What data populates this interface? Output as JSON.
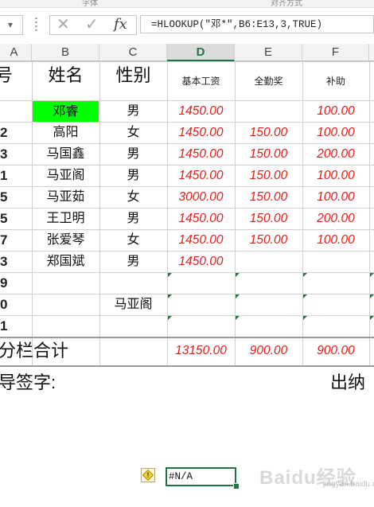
{
  "ribbon": {
    "group_left": "字体",
    "group_right": "对齐方式"
  },
  "formula_bar": {
    "cancel_glyph": "✕",
    "enter_glyph": "✓",
    "fx_label": "fx",
    "formula": "=HLOOKUP(\"邓*\",B6:E13,3,TRUE)"
  },
  "columns": [
    {
      "label": "A",
      "selected": false
    },
    {
      "label": "B",
      "selected": false
    },
    {
      "label": "C",
      "selected": false
    },
    {
      "label": "D",
      "selected": true
    },
    {
      "label": "E",
      "selected": false
    },
    {
      "label": "F",
      "selected": false
    }
  ],
  "table": {
    "headers": {
      "a": "号",
      "b": "姓名",
      "c": "性别",
      "d": "基本工资",
      "e": "全勤奖",
      "f": "补助"
    },
    "rows": [
      {
        "no": "",
        "name": "邓睿",
        "gender": "男",
        "base": "1450.00",
        "attend": "",
        "subsidy": "100.00"
      },
      {
        "no": "2",
        "name": "高阳",
        "gender": "女",
        "base": "1450.00",
        "attend": "150.00",
        "subsidy": "100.00"
      },
      {
        "no": "3",
        "name": "马国鑫",
        "gender": "男",
        "base": "1450.00",
        "attend": "150.00",
        "subsidy": "200.00"
      },
      {
        "no": "1",
        "name": "马亚阁",
        "gender": "男",
        "base": "1450.00",
        "attend": "150.00",
        "subsidy": "100.00"
      },
      {
        "no": "5",
        "name": "马亚茹",
        "gender": "女",
        "base": "3000.00",
        "attend": "150.00",
        "subsidy": "100.00"
      },
      {
        "no": "5",
        "name": "王卫明",
        "gender": "男",
        "base": "1450.00",
        "attend": "150.00",
        "subsidy": "200.00"
      },
      {
        "no": "7",
        "name": "张爱琴",
        "gender": "女",
        "base": "1450.00",
        "attend": "150.00",
        "subsidy": "100.00"
      },
      {
        "no": "3",
        "name": "郑国斌",
        "gender": "男",
        "base": "1450.00",
        "attend": "",
        "subsidy": ""
      },
      {
        "no": "9",
        "name": "",
        "gender": "",
        "base": "",
        "attend": "",
        "subsidy": ""
      },
      {
        "no": "0",
        "name": "",
        "gender": "马亚阁",
        "base": "",
        "attend": "",
        "subsidy": ""
      },
      {
        "no": "1",
        "name": "",
        "gender": "",
        "base": "",
        "attend": "",
        "subsidy": ""
      }
    ],
    "totals": {
      "label": "分栏合计",
      "base": "13150.00",
      "attend": "900.00",
      "subsidy": "900.00"
    }
  },
  "signature": {
    "left": "导签字:",
    "right": "出纳"
  },
  "lookup_cell": {
    "value": "#N/A",
    "warning_icon": "error-warning-icon"
  },
  "colors": {
    "accent_green": "#217346",
    "highlight": "#00ff00",
    "number_red": "#e0201b"
  },
  "watermark": {
    "text": "Baidu经验",
    "sub": "jingyan.baidu.com"
  }
}
